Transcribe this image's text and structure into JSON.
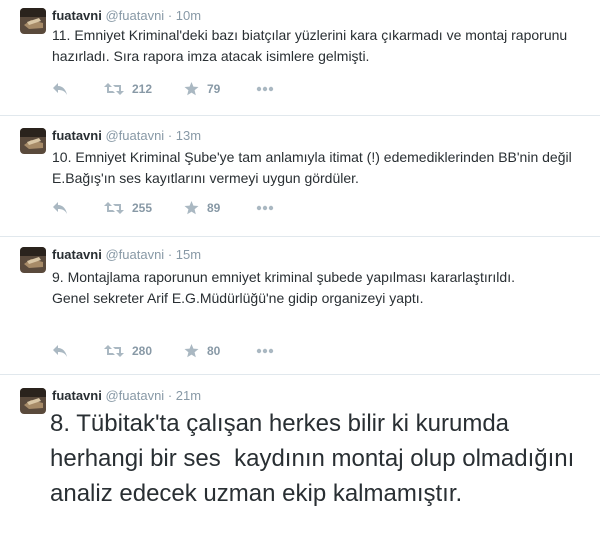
{
  "tweets": [
    {
      "name": "fuatavni",
      "handle": "@fuatavni",
      "separator": "·",
      "time": "10m",
      "text": "11. Emniyet Kriminal'deki bazı biatçılar yüzlerini kara çıkarmadı ve montaj raporunu hazırladı. Sıra rapora imza atacak isimlere gelmişti.",
      "retweets": "212",
      "favorites": "79"
    },
    {
      "name": "fuatavni",
      "handle": "@fuatavni",
      "separator": "·",
      "time": "13m",
      "text": "10. Emniyet Kriminal Şube'ye tam anlamıyla itimat (!) edemediklerinden BB'nin değil E.Bağış'ın ses kayıtlarını vermeyi uygun gördüler.",
      "retweets": "255",
      "favorites": "89"
    },
    {
      "name": "fuatavni",
      "handle": "@fuatavni",
      "separator": "·",
      "time": "15m",
      "text": "9. Montajlama raporunun emniyet kriminal şubede yapılması kararlaştırıldı. Genel sekreter Arif E.G.Müdürlüğü'ne gidip organizeyi yaptı.",
      "retweets": "280",
      "favorites": "80"
    },
    {
      "name": "fuatavni",
      "handle": "@fuatavni",
      "separator": "·",
      "time": "21m",
      "text": "8. Tübitak'ta çalışan herkes bilir ki kurumda herhangi bir ses  kaydının montaj olup olmadığını analiz edecek uzman ekip kalmamıştır."
    }
  ],
  "icons": {
    "reply": "reply-arrow-icon",
    "retweet": "retweet-icon",
    "favorite": "star-icon",
    "more": "more-dots-icon"
  },
  "colors": {
    "icon_gray": "#aab8c2",
    "text": "#292f33",
    "meta": "#8899a6",
    "divider": "#e1e8ed"
  }
}
